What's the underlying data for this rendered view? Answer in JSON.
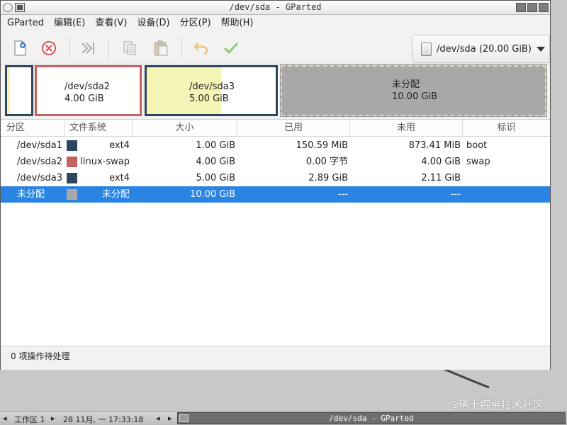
{
  "window": {
    "title": "/dev/sda - GParted"
  },
  "menu": [
    "GParted",
    "编辑(E)",
    "查看(V)",
    "设备(D)",
    "分区(P)",
    "帮助(H)"
  ],
  "toolbar": {
    "icons": [
      "new-icon",
      "delete-icon",
      "resize-move-icon",
      "copy-icon",
      "paste-icon",
      "undo-icon",
      "apply-icon"
    ]
  },
  "device": {
    "label": "/dev/sda (20.00 GiB)"
  },
  "partition_map": [
    {
      "name": "",
      "size": "",
      "color": "#2e4660"
    },
    {
      "name": "/dev/sda2",
      "size": "4.00 GiB",
      "color": "#c4625b"
    },
    {
      "name": "/dev/sda3",
      "size": "5.00 GiB",
      "color": "#2e4660"
    },
    {
      "name": "未分配",
      "size": "10.00 GiB",
      "color": "#a8a8a8"
    }
  ],
  "table": {
    "headers": [
      "分区",
      "文件系统",
      "大小",
      "已用",
      "未用",
      "标识"
    ],
    "rows": [
      {
        "partition": "/dev/sda1",
        "fs": "ext4",
        "color": "#2e4660",
        "size": "1.00 GiB",
        "used": "150.59 MiB",
        "unused": "873.41 MiB",
        "flags": "boot"
      },
      {
        "partition": "/dev/sda2",
        "fs": "linux-swap",
        "color": "#c4625b",
        "size": "4.00 GiB",
        "used": "0.00 字节",
        "unused": "4.00 GiB",
        "flags": "swap"
      },
      {
        "partition": "/dev/sda3",
        "fs": "ext4",
        "color": "#2e4660",
        "size": "5.00 GiB",
        "used": "2.89 GiB",
        "unused": "2.11 GiB",
        "flags": ""
      },
      {
        "partition": "未分配",
        "fs": "未分配",
        "color": "#a8a8a8",
        "size": "10.00 GiB",
        "used": "---",
        "unused": "---",
        "flags": ""
      }
    ]
  },
  "status": {
    "text": "0 项操作待处理"
  },
  "taskbar": {
    "workspace": "工作区 1",
    "datetime": "28 11月, 一 17:33:18",
    "app_title": "/dev/sda - GParted"
  },
  "watermark": "@稀土掘金技术社区"
}
